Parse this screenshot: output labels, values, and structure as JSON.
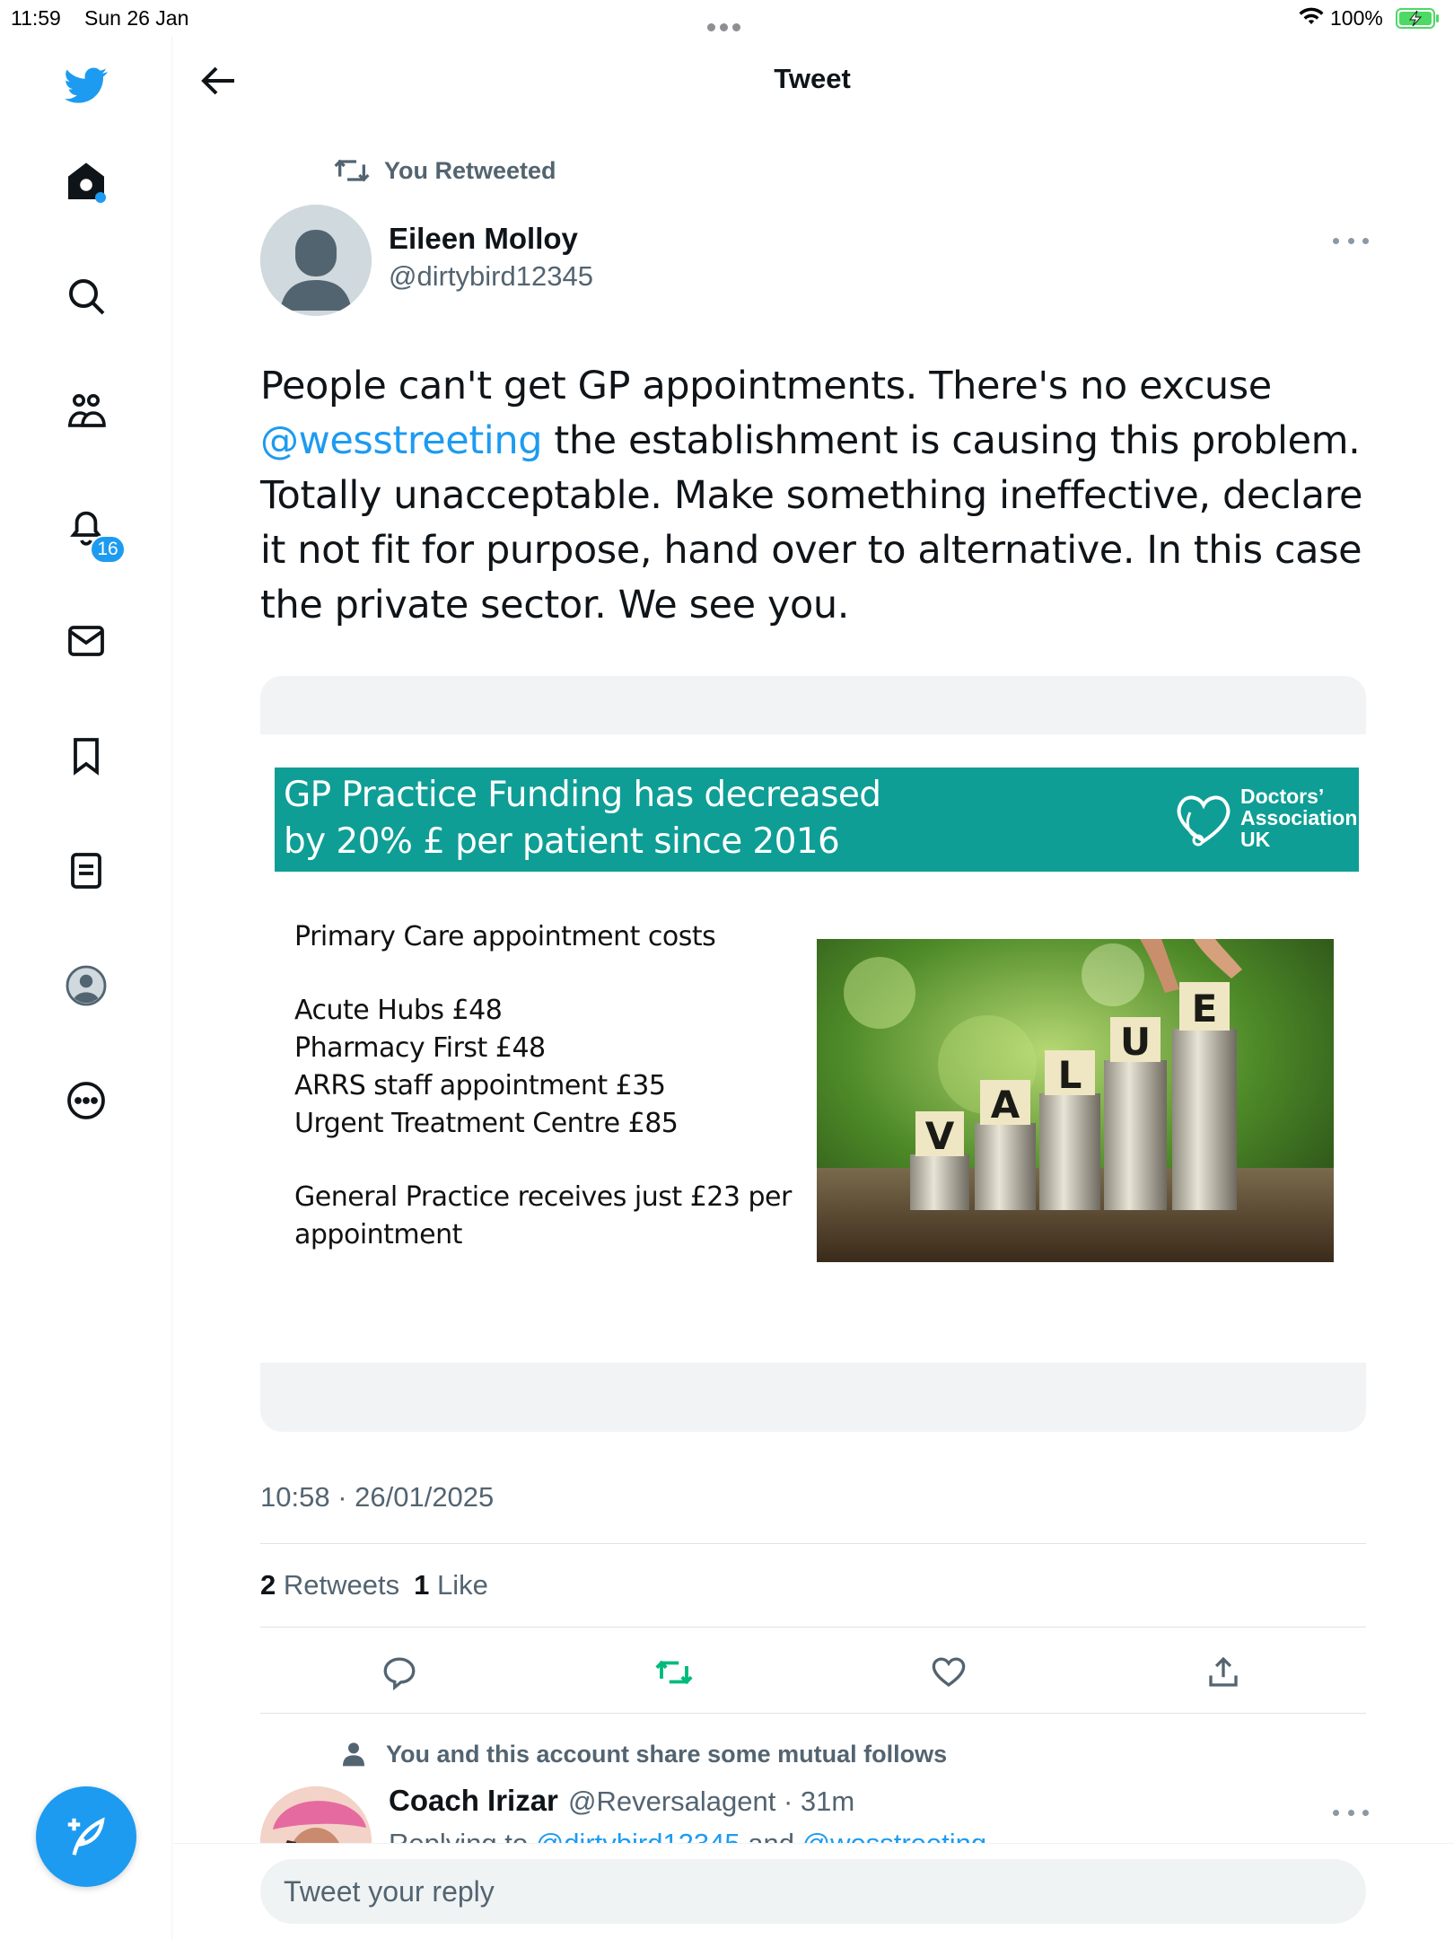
{
  "status_bar": {
    "time": "11:59",
    "date": "Sun 26 Jan",
    "battery": "100%"
  },
  "sidebar": {
    "notifications_badge": "16"
  },
  "header": {
    "title": "Tweet"
  },
  "tweet": {
    "retweet_context": "You Retweeted",
    "author_name": "Eileen Molloy",
    "author_handle": "@dirtybird12345",
    "text_part1": "People can't get GP appointments. There's no excuse",
    "mention": "@wesstreeting",
    "text_part2": "  the establishment is causing this problem. Totally unacceptable. Make something ineffective, declare it not fit for purpose, hand over to alternative.  In this case the private sector. We see you.",
    "timestamp": "10:58 · 26/01/2025",
    "retweets_count": "2",
    "retweets_label": "Retweets",
    "likes_count": "1",
    "likes_label": "Like"
  },
  "media": {
    "banner_line1": "GP Practice Funding has decreased",
    "banner_line2": "by 20% £ per patient since 2016",
    "logo_line1": "Doctors’",
    "logo_line2": "Association",
    "logo_line3": "UK",
    "list_title": "Primary Care appointment costs",
    "items": [
      "Acute Hubs £48",
      "Pharmacy First £48",
      "ARRS staff appointment £35",
      "Urgent Treatment Centre £85"
    ],
    "footer_line1": "General Practice receives just £23 per",
    "footer_line2": "appointment",
    "photo_letters": [
      "V",
      "A",
      "L",
      "U",
      "E"
    ]
  },
  "reply": {
    "social_context": "You and this account share some mutual follows",
    "author_name": "Coach Irizar",
    "meta": "@Reversalagent · 31m",
    "replying_prefix": "Replying to ",
    "replying_mention1": "@dirtybird12345",
    "replying_and": " and ",
    "replying_mention2": "@wesstreeting"
  },
  "composer": {
    "placeholder": "Tweet your reply"
  },
  "colors": {
    "accent": "#1d9bf0",
    "retweet_green": "#00ba7c",
    "banner_teal": "#0e9e95",
    "secondary_text": "#536471"
  }
}
